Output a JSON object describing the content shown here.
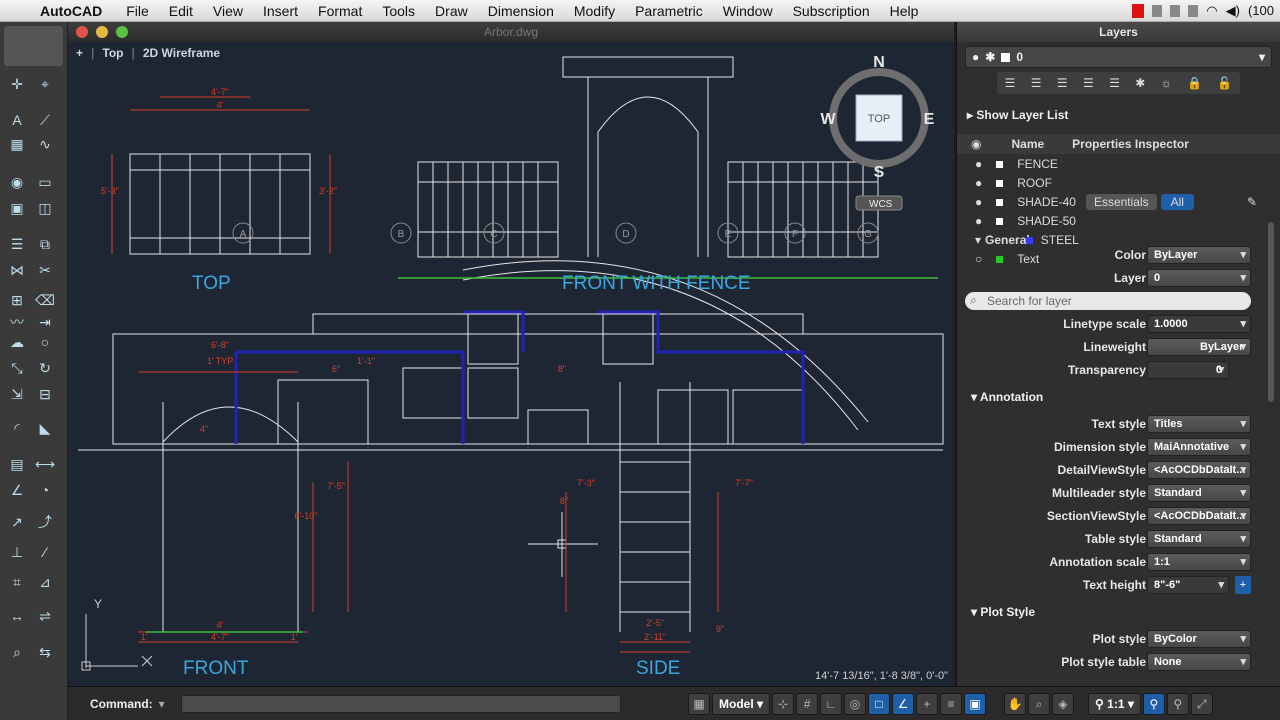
{
  "menubar": {
    "app_name": "AutoCAD",
    "items": [
      "File",
      "Edit",
      "View",
      "Insert",
      "Format",
      "Tools",
      "Draw",
      "Dimension",
      "Modify",
      "Parametric",
      "Window",
      "Subscription",
      "Help"
    ],
    "battery": "(100"
  },
  "window": {
    "title": "Arbor.dwg",
    "viewport_view": "Top",
    "viewport_style": "2D Wireframe"
  },
  "viewcube": {
    "north": "N",
    "south": "S",
    "east": "E",
    "west": "W",
    "face": "TOP",
    "ucs": "WCS"
  },
  "drawing": {
    "labels": {
      "top": "TOP",
      "front_fence": "FRONT WITH FENCE",
      "front": "FRONT",
      "side": "SIDE"
    },
    "grid_bubbles": [
      "A",
      "B",
      "C",
      "D",
      "E",
      "F",
      "G"
    ],
    "dimensions": [
      "4'-7\"",
      "4'",
      "5'-3\"",
      "3'-2\"",
      "6'-8\"",
      "1' TYP",
      "1'-1\"",
      "6\"",
      "4\"",
      "8\"",
      "7'-3\"",
      "7'-5\"",
      "6'-10\"",
      "8\"",
      "2'-5\"",
      "2'-11\"",
      "7'-7\"",
      "9\"",
      "4'-7\"",
      "1'",
      "1'",
      "4'"
    ],
    "coordinates": "14'-7 13/16\", 1'-8 3/8\", 0'-0\""
  },
  "layers_panel": {
    "title": "Layers",
    "current_layer": "0",
    "show_layer_list": "Show Layer List",
    "list_header": "Name",
    "layers": [
      {
        "name": "FENCE",
        "color": "#ffffff"
      },
      {
        "name": "ROOF",
        "color": "#ffffff"
      },
      {
        "name": "SHADE-40",
        "color": "#ffffff"
      },
      {
        "name": "SHADE-50",
        "color": "#ffffff"
      },
      {
        "name": "STEEL",
        "color": "#3b3bff"
      },
      {
        "name": "Text",
        "color": "#22cc22"
      }
    ],
    "search_placeholder": "Search for layer"
  },
  "properties": {
    "title": "Properties Inspector",
    "tabs": [
      "Essentials",
      "All"
    ],
    "active_tab": "All",
    "sections": {
      "general": "General",
      "annotation": "Annotation",
      "plot_style": "Plot Style"
    },
    "general": [
      {
        "label": "Color",
        "value": "ByLayer"
      },
      {
        "label": "Layer",
        "value": "0"
      },
      {
        "label": "Linetype scale",
        "value": "1.0000"
      },
      {
        "label": "Lineweight",
        "value": "ByLayer"
      },
      {
        "label": "Transparency",
        "value": "0"
      }
    ],
    "annotation": [
      {
        "label": "Text style",
        "value": "Titles"
      },
      {
        "label": "Dimension style",
        "value": "MaiAnnotative"
      },
      {
        "label": "DetailViewStyle",
        "value": "<AcOCDbDataIt..."
      },
      {
        "label": "Multileader style",
        "value": "Standard"
      },
      {
        "label": "SectionViewStyle",
        "value": "<AcOCDbDataIt..."
      },
      {
        "label": "Table style",
        "value": "Standard"
      },
      {
        "label": "Annotation scale",
        "value": "1:1"
      },
      {
        "label": "Text height",
        "value": "8\"-6\""
      }
    ],
    "plot_style": [
      {
        "label": "Plot style",
        "value": "ByColor"
      },
      {
        "label": "Plot style table",
        "value": "None"
      }
    ]
  },
  "command": {
    "label": "Command:"
  },
  "status": {
    "model": "Model",
    "scale": "1:1"
  },
  "colors": {
    "drawing_bg": "#1f2633",
    "blue_text": "#3aa7e0",
    "dim_red": "#d2402a",
    "steel_blue": "#2222b8",
    "grid_green": "#3bbd3b"
  }
}
